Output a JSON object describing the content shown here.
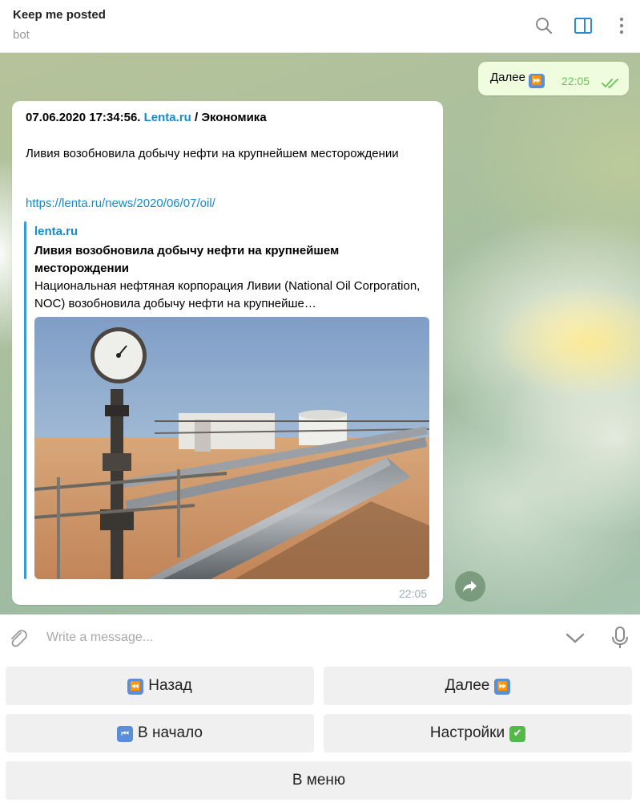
{
  "header": {
    "title": "Keep me posted",
    "subtitle": "bot",
    "icons": [
      "search-icon",
      "sidebar-toggle-icon",
      "more-icon"
    ]
  },
  "messages": {
    "outgoing": {
      "text": "Далее",
      "emoji": "⏩",
      "time": "22:05",
      "status": "read"
    },
    "incoming": {
      "header_prefix": "07.06.2020 17:34:56.",
      "header_link": "Lenta.ru",
      "header_suffix": "/ Экономика",
      "body": "Ливия возобновила добычу нефти на крупнейшем месторождении",
      "url": "https://lenta.ru/news/2020/06/07/oil/",
      "preview": {
        "site": "lenta.ru",
        "title": "Ливия возобновила добычу нефти на крупнейшем месторождении",
        "description": "Национальная нефтяная корпорация Ливии (National Oil Corporation, NOC) возобновила добычу нефти на крупнейше…"
      },
      "time": "22:05"
    }
  },
  "composer": {
    "placeholder": "Write a message..."
  },
  "keyboard": {
    "back": {
      "label": "Назад",
      "emoji": "⏪"
    },
    "next": {
      "label": "Далее",
      "emoji": "⏩"
    },
    "start": {
      "label": "В начало",
      "emoji": "⏮"
    },
    "settings": {
      "label": "Настройки",
      "emoji": "✔"
    },
    "menu": {
      "label": "В меню"
    }
  },
  "colors": {
    "accent": "#168acd",
    "outgoing_bubble": "#effdde",
    "read_check": "#6ac05a",
    "keyboard_button": "#f0f0f0"
  }
}
